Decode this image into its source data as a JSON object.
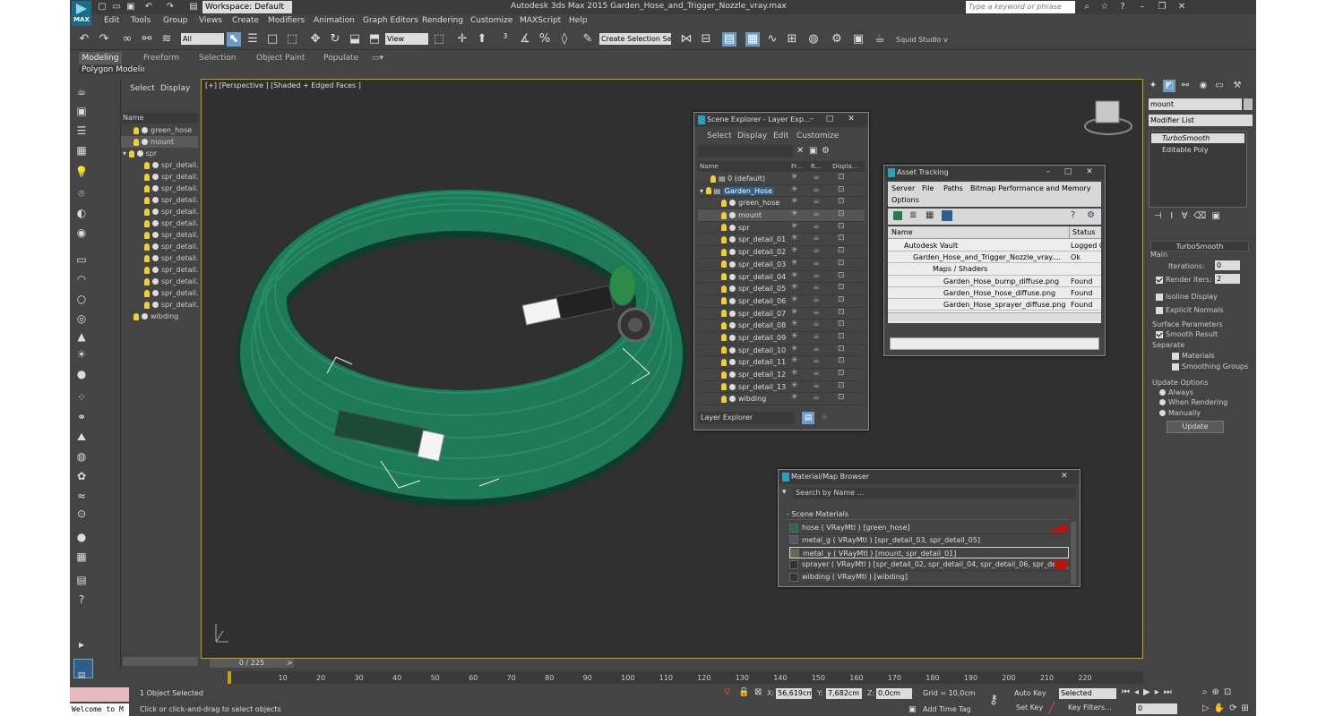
{
  "titlebar": {
    "logo": "MAX",
    "workspace": "Workspace: Default",
    "title": "Autodesk 3ds Max 2015      Garden_Hose_and_Trigger_Nozzle_vray.max",
    "search_placeholder": "Type a keyword or phrase"
  },
  "menu": [
    "Edit",
    "Tools",
    "Group",
    "Views",
    "Create",
    "Modifiers",
    "Animation",
    "Graph Editors",
    "Rendering",
    "Customize",
    "MAXScript",
    "Help"
  ],
  "toolbar": {
    "filter": "All",
    "view": "View",
    "selection_set": "Create Selection Se",
    "squid": "Squid Studio v"
  },
  "ribbon": {
    "tabs": [
      "Modeling",
      "Freeform",
      "Selection",
      "Object Paint",
      "Populate"
    ],
    "sub": "Polygon Modeling"
  },
  "scene_list": {
    "tabs": [
      "Select",
      "Display"
    ],
    "col": "Name",
    "items": [
      "green_hose",
      "mount",
      "spr",
      "spr_detail.",
      "spr_detail.",
      "spr_detail.",
      "spr_detail.",
      "spr_detail.",
      "spr_detail.",
      "spr_detail.",
      "spr_detail.",
      "spr_detail.",
      "spr_detail.",
      "spr_detail.",
      "spr_detail.",
      "spr_detail.",
      "wibding"
    ]
  },
  "viewport": {
    "label": "[+] [Perspective ] [Shaded + Edged Faces ]"
  },
  "layer_explorer": {
    "title": "Scene Explorer - Layer Exp...",
    "menus": [
      "Select",
      "Display",
      "Edit",
      "Customize"
    ],
    "cols": [
      "Name",
      "Fr...",
      "R...",
      "Displa..."
    ],
    "rows": [
      "0 (default)",
      "Garden_Hose",
      "green_hose",
      "mount",
      "spr",
      "spr_detail_01",
      "spr_detail_02",
      "spr_detail_03",
      "spr_detail_04",
      "spr_detail_05",
      "spr_detail_06",
      "spr_detail_07",
      "spr_detail_08",
      "spr_detail_09",
      "spr_detail_10",
      "spr_detail_11",
      "spr_detail_12",
      "spr_detail_13",
      "wibding"
    ],
    "footer": "Layer Explorer"
  },
  "asset_tracking": {
    "title": "Asset Tracking",
    "menus": [
      "Server",
      "File",
      "Paths",
      "Bitmap Performance and Memory",
      "Options"
    ],
    "cols": [
      "Name",
      "Status"
    ],
    "rows": [
      {
        "name": "Autodesk Vault",
        "status": "Logged O"
      },
      {
        "name": "Garden_Hose_and_Trigger_Nozzle_vray....",
        "status": "Ok"
      },
      {
        "name": "Maps / Shaders",
        "status": ""
      },
      {
        "name": "Garden_Hose_bump_diffuse.png",
        "status": "Found"
      },
      {
        "name": "Garden_Hose_hose_diffuse.png",
        "status": "Found"
      },
      {
        "name": "Garden_Hose_sprayer_diffuse.png",
        "status": "Found"
      }
    ]
  },
  "material_browser": {
    "title": "Material/Map Browser",
    "search": "Search by Name ...",
    "group": "- Scene Materials",
    "rows": [
      "hose  ( VRayMtl ) [green_hose]",
      "metal_g  ( VRayMtl ) [spr_detail_03, spr_detail_05]",
      "metal_y  ( VRayMtl ) [mount, spr_detail_01]",
      "sprayer  ( VRayMtl ) [spr_detail_02, spr_detail_04, spr_detail_06, spr_detail_07,...",
      "wibding  ( VRayMtl ) [wibding]"
    ]
  },
  "right_panel": {
    "name": "mount",
    "modifier_list": "Modifier List",
    "stack": [
      "TurboSmooth",
      "Editable Poly"
    ],
    "rollout": "TurboSmooth",
    "main": "Main",
    "iterations_label": "Iterations:",
    "iterations": "0",
    "render_iters_label": "Render Iters:",
    "render_iters": "2",
    "isoline": "Isoline Display",
    "explicit": "Explicit Normals",
    "surface": "Surface Parameters",
    "smooth": "Smooth Result",
    "separate": "Separate",
    "materials": "Materials",
    "smoothing": "Smoothing Groups",
    "update_opts": "Update Options",
    "always": "Always",
    "when_rendering": "When Rendering",
    "manually": "Manually",
    "update": "Update"
  },
  "timeline": {
    "frame": "0 / 225",
    "ticks": [
      "10",
      "20",
      "30",
      "40",
      "50",
      "60",
      "70",
      "80",
      "90",
      "100",
      "110",
      "120",
      "130",
      "140",
      "150",
      "160",
      "170",
      "180",
      "190",
      "200",
      "210",
      "220"
    ]
  },
  "status": {
    "welcome": "Welcome to M",
    "selected": "1 Object Selected",
    "hint": "Click or click-and-drag to select objects",
    "x_label": "X:",
    "x": "56,619cm",
    "y_label": "Y:",
    "y": "7,682cm",
    "z_label": "Z:",
    "z": "0,0cm",
    "grid": "Grid = 10,0cm",
    "add_time_tag": "Add Time Tag",
    "auto_key": "Auto Key",
    "selected_dd": "Selected",
    "set_key": "Set Key",
    "key_filters": "Key Filters...",
    "frame_field": "0"
  },
  "colors": {
    "hose": "#1f7a5a",
    "accent": "#c8a000",
    "select": "#6a9cc8"
  }
}
